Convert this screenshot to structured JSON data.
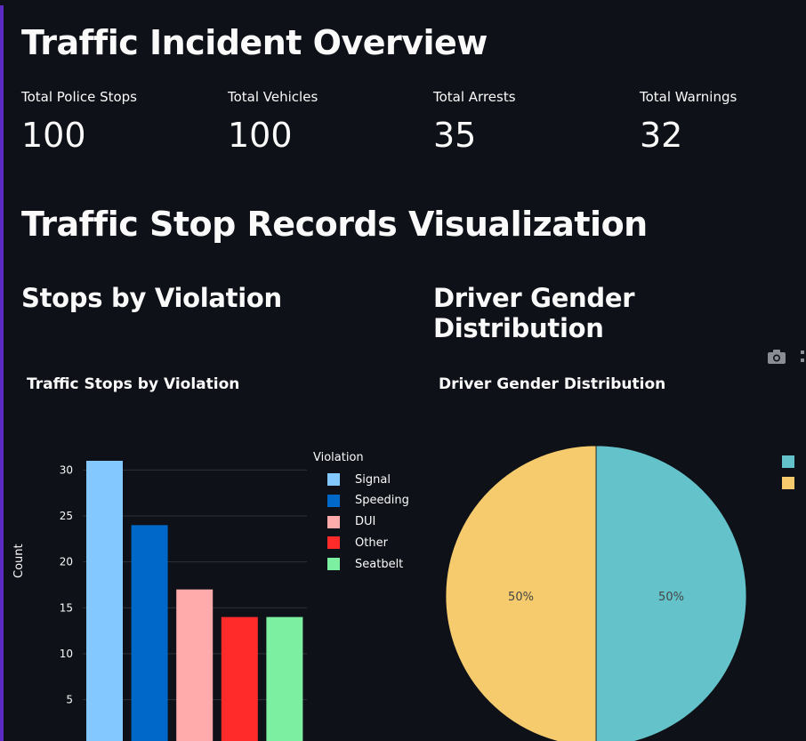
{
  "header": {
    "title": "Traffic Incident Overview"
  },
  "metrics": [
    {
      "label": "Total Police Stops",
      "value": "100"
    },
    {
      "label": "Total Vehicles",
      "value": "100"
    },
    {
      "label": "Total Arrests",
      "value": "35"
    },
    {
      "label": "Total Warnings",
      "value": "32"
    }
  ],
  "section": {
    "title": "Traffic Stop Records Visualization"
  },
  "left_panel": {
    "title": "Stops by Violation"
  },
  "right_panel": {
    "title": "Driver Gender Distribution"
  },
  "toolbar": {
    "icons": [
      "camera-icon",
      "more-icon"
    ]
  },
  "chart_data": [
    {
      "type": "bar",
      "title": "Traffic Stops by Violation",
      "ylabel": "Count",
      "xlabel": "",
      "legend_title": "Violation",
      "legend_position": "right",
      "categories": [
        "Signal",
        "Speeding",
        "DUI",
        "Other",
        "Seatbelt"
      ],
      "values": [
        31,
        24,
        17,
        14,
        14
      ],
      "colors": [
        "#83c9ff",
        "#0068c9",
        "#ffabab",
        "#ff2b2b",
        "#7defa1"
      ],
      "yticks": [
        5,
        10,
        15,
        20,
        25,
        30
      ],
      "grid": true
    },
    {
      "type": "pie",
      "title": "Driver Gender Distribution",
      "values": [
        50,
        50
      ],
      "slice_labels": [
        "50%",
        "50%"
      ],
      "colors": [
        "#64c3ca",
        "#f5cb6e"
      ],
      "legend_position": "right"
    }
  ]
}
